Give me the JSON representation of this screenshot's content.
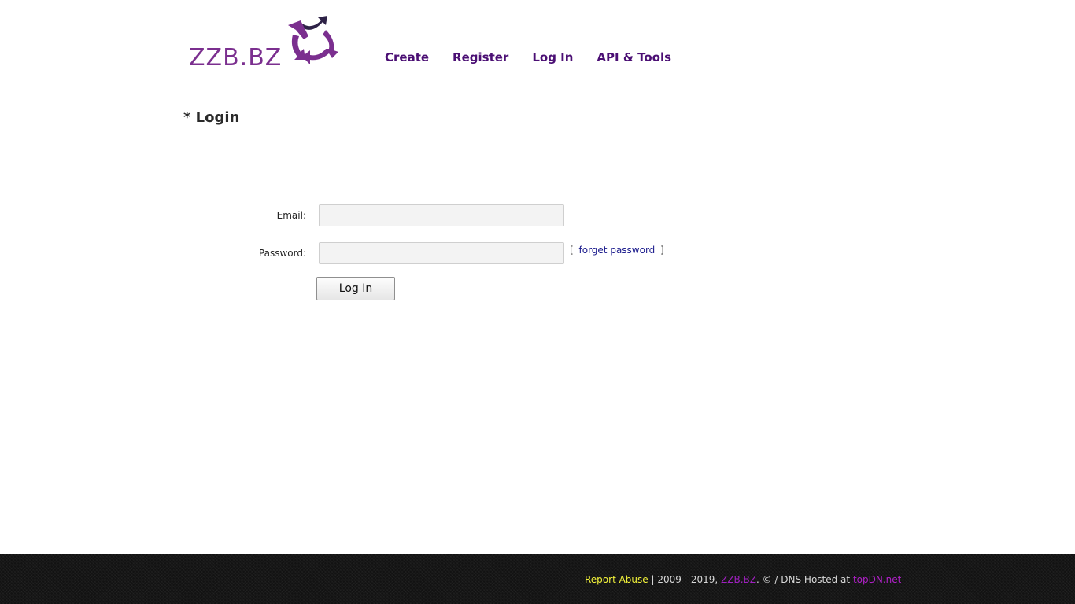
{
  "header": {
    "logo_text": "ZZB.BZ",
    "nav": [
      {
        "label": "Create"
      },
      {
        "label": "Register"
      },
      {
        "label": "Log In"
      },
      {
        "label": "API & Tools"
      }
    ]
  },
  "main": {
    "title": "* Login",
    "email_label": "Email:",
    "email_value": "",
    "password_label": "Password:",
    "password_value": "",
    "forget_open": "[",
    "forget_link": "forget password",
    "forget_close": "]",
    "login_button": "Log In"
  },
  "footer": {
    "report_abuse": "Report Abuse",
    "sep1": " | 2009 - 2019, ",
    "brand": "ZZB.BZ",
    "sep2": ". © / DNS Hosted at ",
    "host": "topDN.net"
  },
  "colors": {
    "nav_text": "#4b0f74",
    "logo_purple": "#7b2f8f",
    "footer_bg": "#121212",
    "report_abuse": "#f2f23a",
    "link_magenta": "#a020c0"
  },
  "icons": {
    "logo_mark": "circular-arrows-icon"
  }
}
